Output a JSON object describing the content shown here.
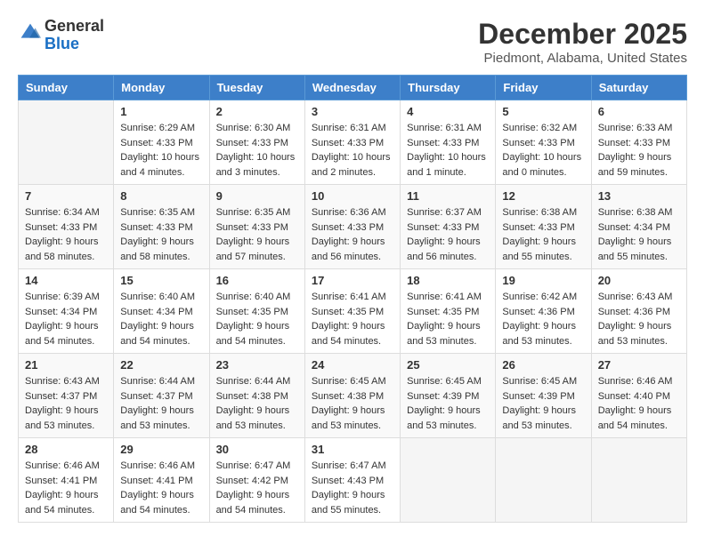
{
  "header": {
    "logo_line1": "General",
    "logo_line2": "Blue",
    "month_title": "December 2025",
    "location": "Piedmont, Alabama, United States"
  },
  "days_of_week": [
    "Sunday",
    "Monday",
    "Tuesday",
    "Wednesday",
    "Thursday",
    "Friday",
    "Saturday"
  ],
  "weeks": [
    [
      {
        "day": "",
        "sunrise": "",
        "sunset": "",
        "daylight": "",
        "empty": true
      },
      {
        "day": "1",
        "sunrise": "Sunrise: 6:29 AM",
        "sunset": "Sunset: 4:33 PM",
        "daylight": "Daylight: 10 hours and 4 minutes.",
        "empty": false
      },
      {
        "day": "2",
        "sunrise": "Sunrise: 6:30 AM",
        "sunset": "Sunset: 4:33 PM",
        "daylight": "Daylight: 10 hours and 3 minutes.",
        "empty": false
      },
      {
        "day": "3",
        "sunrise": "Sunrise: 6:31 AM",
        "sunset": "Sunset: 4:33 PM",
        "daylight": "Daylight: 10 hours and 2 minutes.",
        "empty": false
      },
      {
        "day": "4",
        "sunrise": "Sunrise: 6:31 AM",
        "sunset": "Sunset: 4:33 PM",
        "daylight": "Daylight: 10 hours and 1 minute.",
        "empty": false
      },
      {
        "day": "5",
        "sunrise": "Sunrise: 6:32 AM",
        "sunset": "Sunset: 4:33 PM",
        "daylight": "Daylight: 10 hours and 0 minutes.",
        "empty": false
      },
      {
        "day": "6",
        "sunrise": "Sunrise: 6:33 AM",
        "sunset": "Sunset: 4:33 PM",
        "daylight": "Daylight: 9 hours and 59 minutes.",
        "empty": false
      }
    ],
    [
      {
        "day": "7",
        "sunrise": "Sunrise: 6:34 AM",
        "sunset": "Sunset: 4:33 PM",
        "daylight": "Daylight: 9 hours and 58 minutes.",
        "empty": false
      },
      {
        "day": "8",
        "sunrise": "Sunrise: 6:35 AM",
        "sunset": "Sunset: 4:33 PM",
        "daylight": "Daylight: 9 hours and 58 minutes.",
        "empty": false
      },
      {
        "day": "9",
        "sunrise": "Sunrise: 6:35 AM",
        "sunset": "Sunset: 4:33 PM",
        "daylight": "Daylight: 9 hours and 57 minutes.",
        "empty": false
      },
      {
        "day": "10",
        "sunrise": "Sunrise: 6:36 AM",
        "sunset": "Sunset: 4:33 PM",
        "daylight": "Daylight: 9 hours and 56 minutes.",
        "empty": false
      },
      {
        "day": "11",
        "sunrise": "Sunrise: 6:37 AM",
        "sunset": "Sunset: 4:33 PM",
        "daylight": "Daylight: 9 hours and 56 minutes.",
        "empty": false
      },
      {
        "day": "12",
        "sunrise": "Sunrise: 6:38 AM",
        "sunset": "Sunset: 4:33 PM",
        "daylight": "Daylight: 9 hours and 55 minutes.",
        "empty": false
      },
      {
        "day": "13",
        "sunrise": "Sunrise: 6:38 AM",
        "sunset": "Sunset: 4:34 PM",
        "daylight": "Daylight: 9 hours and 55 minutes.",
        "empty": false
      }
    ],
    [
      {
        "day": "14",
        "sunrise": "Sunrise: 6:39 AM",
        "sunset": "Sunset: 4:34 PM",
        "daylight": "Daylight: 9 hours and 54 minutes.",
        "empty": false
      },
      {
        "day": "15",
        "sunrise": "Sunrise: 6:40 AM",
        "sunset": "Sunset: 4:34 PM",
        "daylight": "Daylight: 9 hours and 54 minutes.",
        "empty": false
      },
      {
        "day": "16",
        "sunrise": "Sunrise: 6:40 AM",
        "sunset": "Sunset: 4:35 PM",
        "daylight": "Daylight: 9 hours and 54 minutes.",
        "empty": false
      },
      {
        "day": "17",
        "sunrise": "Sunrise: 6:41 AM",
        "sunset": "Sunset: 4:35 PM",
        "daylight": "Daylight: 9 hours and 54 minutes.",
        "empty": false
      },
      {
        "day": "18",
        "sunrise": "Sunrise: 6:41 AM",
        "sunset": "Sunset: 4:35 PM",
        "daylight": "Daylight: 9 hours and 53 minutes.",
        "empty": false
      },
      {
        "day": "19",
        "sunrise": "Sunrise: 6:42 AM",
        "sunset": "Sunset: 4:36 PM",
        "daylight": "Daylight: 9 hours and 53 minutes.",
        "empty": false
      },
      {
        "day": "20",
        "sunrise": "Sunrise: 6:43 AM",
        "sunset": "Sunset: 4:36 PM",
        "daylight": "Daylight: 9 hours and 53 minutes.",
        "empty": false
      }
    ],
    [
      {
        "day": "21",
        "sunrise": "Sunrise: 6:43 AM",
        "sunset": "Sunset: 4:37 PM",
        "daylight": "Daylight: 9 hours and 53 minutes.",
        "empty": false
      },
      {
        "day": "22",
        "sunrise": "Sunrise: 6:44 AM",
        "sunset": "Sunset: 4:37 PM",
        "daylight": "Daylight: 9 hours and 53 minutes.",
        "empty": false
      },
      {
        "day": "23",
        "sunrise": "Sunrise: 6:44 AM",
        "sunset": "Sunset: 4:38 PM",
        "daylight": "Daylight: 9 hours and 53 minutes.",
        "empty": false
      },
      {
        "day": "24",
        "sunrise": "Sunrise: 6:45 AM",
        "sunset": "Sunset: 4:38 PM",
        "daylight": "Daylight: 9 hours and 53 minutes.",
        "empty": false
      },
      {
        "day": "25",
        "sunrise": "Sunrise: 6:45 AM",
        "sunset": "Sunset: 4:39 PM",
        "daylight": "Daylight: 9 hours and 53 minutes.",
        "empty": false
      },
      {
        "day": "26",
        "sunrise": "Sunrise: 6:45 AM",
        "sunset": "Sunset: 4:39 PM",
        "daylight": "Daylight: 9 hours and 53 minutes.",
        "empty": false
      },
      {
        "day": "27",
        "sunrise": "Sunrise: 6:46 AM",
        "sunset": "Sunset: 4:40 PM",
        "daylight": "Daylight: 9 hours and 54 minutes.",
        "empty": false
      }
    ],
    [
      {
        "day": "28",
        "sunrise": "Sunrise: 6:46 AM",
        "sunset": "Sunset: 4:41 PM",
        "daylight": "Daylight: 9 hours and 54 minutes.",
        "empty": false
      },
      {
        "day": "29",
        "sunrise": "Sunrise: 6:46 AM",
        "sunset": "Sunset: 4:41 PM",
        "daylight": "Daylight: 9 hours and 54 minutes.",
        "empty": false
      },
      {
        "day": "30",
        "sunrise": "Sunrise: 6:47 AM",
        "sunset": "Sunset: 4:42 PM",
        "daylight": "Daylight: 9 hours and 54 minutes.",
        "empty": false
      },
      {
        "day": "31",
        "sunrise": "Sunrise: 6:47 AM",
        "sunset": "Sunset: 4:43 PM",
        "daylight": "Daylight: 9 hours and 55 minutes.",
        "empty": false
      },
      {
        "day": "",
        "sunrise": "",
        "sunset": "",
        "daylight": "",
        "empty": true
      },
      {
        "day": "",
        "sunrise": "",
        "sunset": "",
        "daylight": "",
        "empty": true
      },
      {
        "day": "",
        "sunrise": "",
        "sunset": "",
        "daylight": "",
        "empty": true
      }
    ]
  ]
}
